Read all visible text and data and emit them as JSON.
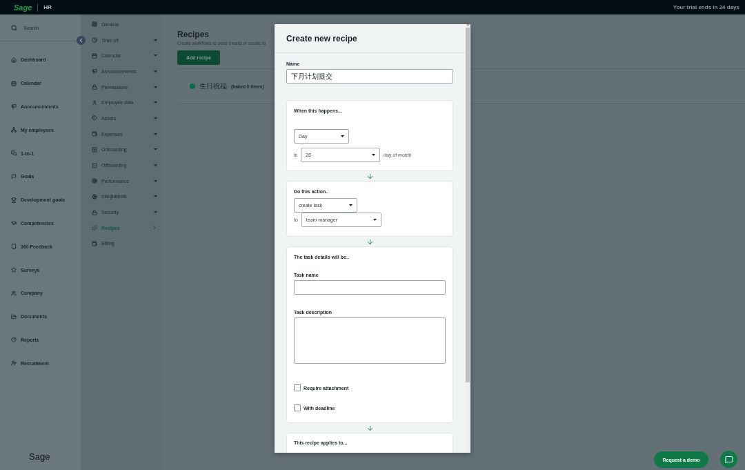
{
  "top_bar": {
    "logo": "Sage",
    "product": "HR",
    "trial_notice": "Your trial ends in 24 days"
  },
  "sidebar": {
    "search": {
      "placeholder": "Search"
    },
    "items": [
      {
        "label": "Dashboard"
      },
      {
        "label": "Calendar"
      },
      {
        "label": "Announcements"
      },
      {
        "label": "My employees"
      },
      {
        "label": "1-to-1"
      },
      {
        "label": "Goals"
      },
      {
        "label": "Development goals"
      },
      {
        "label": "Competencies"
      },
      {
        "label": "360 Feedback"
      },
      {
        "label": "Surveys"
      },
      {
        "label": "Company"
      },
      {
        "label": "Documents"
      },
      {
        "label": "Reports"
      },
      {
        "label": "Recruitment"
      }
    ],
    "footer_logo": "Sage"
  },
  "settings_menu": {
    "items": [
      {
        "label": "General",
        "kind": "page",
        "selected": false
      },
      {
        "label": "Time off",
        "kind": "group",
        "selected": false
      },
      {
        "label": "Calendar",
        "kind": "group",
        "selected": false
      },
      {
        "label": "Announcements",
        "kind": "group",
        "selected": false
      },
      {
        "label": "Permissions",
        "kind": "group",
        "selected": false
      },
      {
        "label": "Employee data",
        "kind": "group",
        "selected": false
      },
      {
        "label": "Assets",
        "kind": "group",
        "selected": false
      },
      {
        "label": "Expenses",
        "kind": "group",
        "selected": false
      },
      {
        "label": "Onboarding",
        "kind": "group",
        "selected": false
      },
      {
        "label": "Offboarding",
        "kind": "group",
        "selected": false
      },
      {
        "label": "Performance",
        "kind": "group",
        "selected": false
      },
      {
        "label": "Integrations",
        "kind": "group",
        "selected": false
      },
      {
        "label": "Security",
        "kind": "group",
        "selected": false
      },
      {
        "label": "Recipes",
        "kind": "page",
        "selected": true
      },
      {
        "label": "Billing",
        "kind": "page",
        "selected": false
      }
    ]
  },
  "page": {
    "title": "Recipes",
    "subtitle": "Create workflows to send emails or create ta",
    "add_button": "Add recipe",
    "recipes": [
      {
        "name": "生日祝福",
        "meta": "(baked 0 times)",
        "color": "#0b6b45"
      }
    ]
  },
  "modal": {
    "title": "Create new recipe",
    "name_field": {
      "label": "Name",
      "value": "下月计划提交"
    },
    "trigger": {
      "heading": "When this happens...",
      "unit_select": "Day",
      "prefix": "is",
      "day_select": "28",
      "suffix": "day of month"
    },
    "action": {
      "heading": "Do this action..",
      "action_select": "create task",
      "prefix": "to",
      "target_select": "team manager"
    },
    "details": {
      "heading": "The task details will be..",
      "task_name_label": "Task name",
      "task_description_label": "Task description",
      "checkboxes": [
        {
          "label": "Require attachment",
          "checked": false
        },
        {
          "label": "With deadline",
          "checked": false
        }
      ]
    },
    "applies": {
      "heading": "This recipe applies to..."
    }
  },
  "request_demo_button": "Request a demo"
}
